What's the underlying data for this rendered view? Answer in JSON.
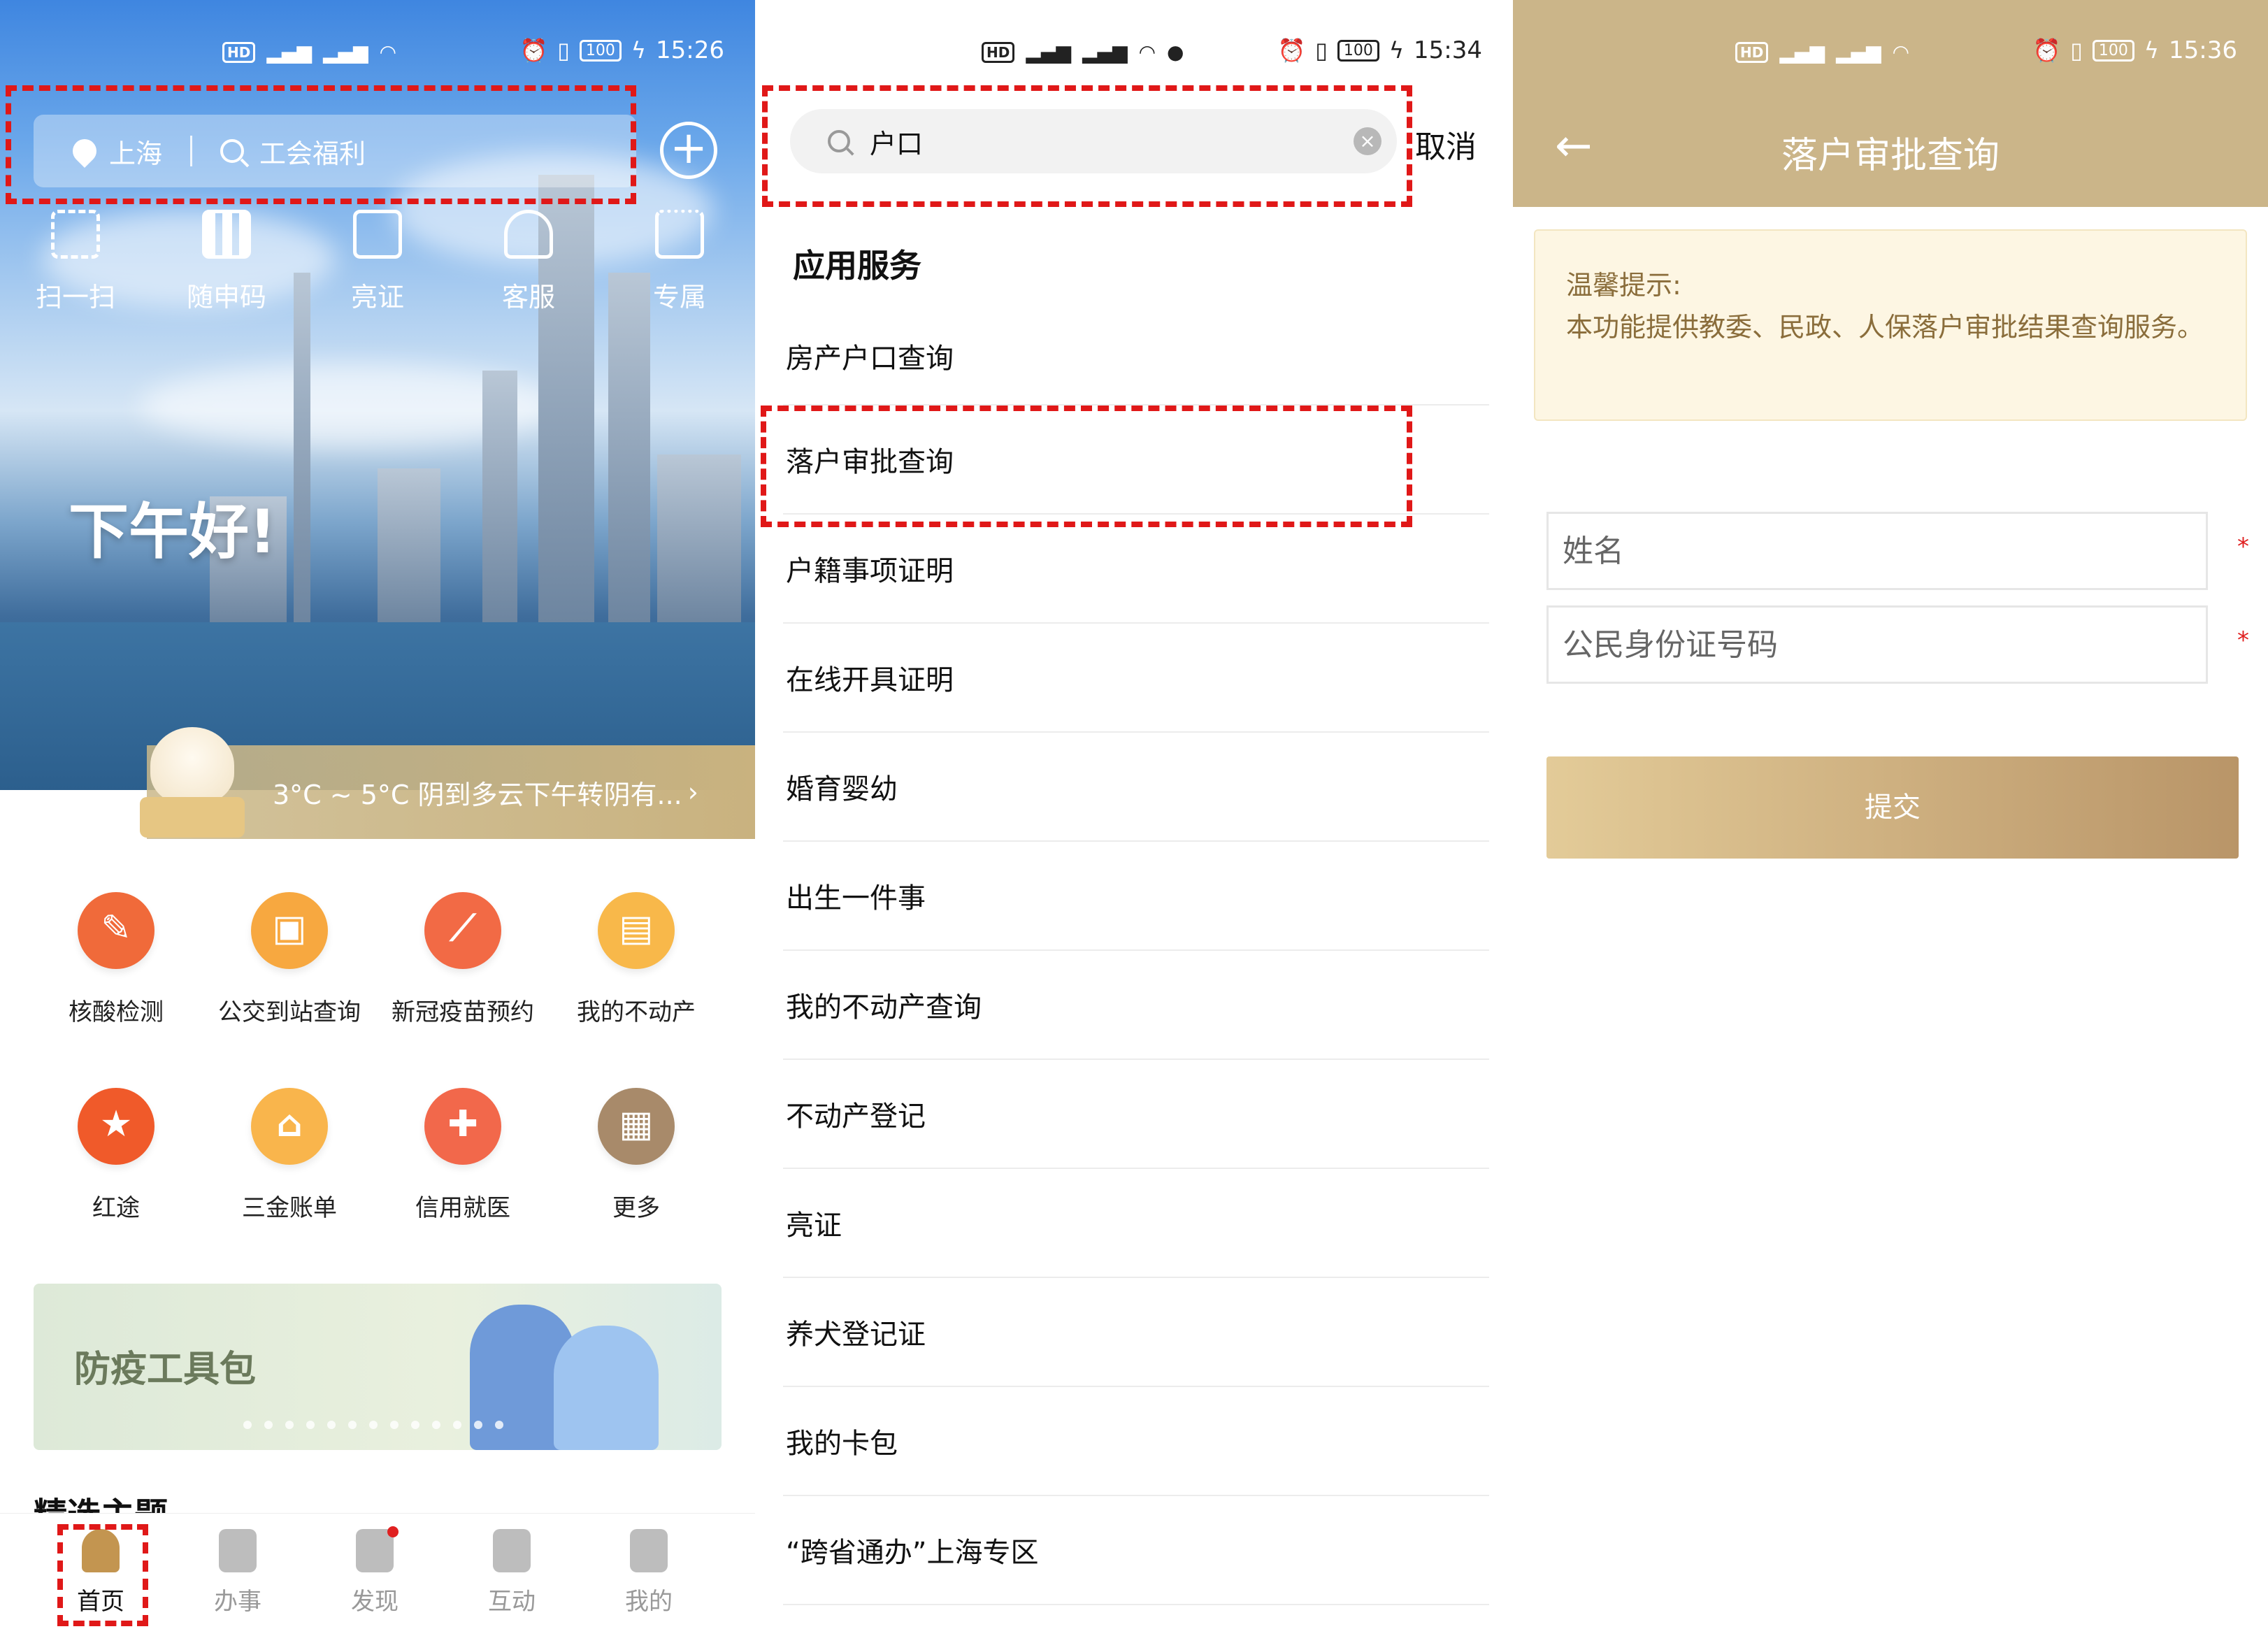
{
  "colors": {
    "accent_gold": "#c39550",
    "highlight_red": "#e01818",
    "header_gold": "#cbb589"
  },
  "panel1": {
    "status": {
      "time": "15:26",
      "battery": "100"
    },
    "city": "上海",
    "search_hint": "工会福利",
    "quick_actions": [
      {
        "label": "扫一扫",
        "icon": "scan-icon"
      },
      {
        "label": "随申码",
        "icon": "qr-code-icon"
      },
      {
        "label": "亮证",
        "icon": "id-card-icon"
      },
      {
        "label": "客服",
        "icon": "headset-icon"
      },
      {
        "label": "专属",
        "icon": "crown-icon"
      }
    ],
    "greeting": "下午好!",
    "weather": "3°C ~ 5°C  阴到多云下午转阴有...",
    "services": [
      {
        "label": "核酸检测",
        "icon": "swab-icon",
        "color": "#f06a3a"
      },
      {
        "label": "公交到站查询",
        "icon": "bus-icon",
        "color": "#f7a840"
      },
      {
        "label": "新冠疫苗预约",
        "icon": "syringe-icon",
        "color": "#f26a45"
      },
      {
        "label": "我的不动产",
        "icon": "document-icon",
        "color": "#f8b84a"
      },
      {
        "label": "红途",
        "icon": "star-flag-icon",
        "color": "#f05a2a"
      },
      {
        "label": "三金账单",
        "icon": "money-house-icon",
        "color": "#f9b54c"
      },
      {
        "label": "信用就医",
        "icon": "medical-card-icon",
        "color": "#f2684b"
      },
      {
        "label": "更多",
        "icon": "grid-more-icon",
        "color": "#a88a6a"
      }
    ],
    "banner_title": "防疫工具包",
    "section_heading": "精选主题",
    "tabs": [
      {
        "label": "首页",
        "icon": "home-icon"
      },
      {
        "label": "办事",
        "icon": "pen-icon"
      },
      {
        "label": "发现",
        "icon": "discover-icon"
      },
      {
        "label": "互动",
        "icon": "lotus-icon"
      },
      {
        "label": "我的",
        "icon": "profile-icon"
      }
    ]
  },
  "panel2": {
    "status": {
      "time": "15:34",
      "battery": "100"
    },
    "search_value": "户口",
    "cancel_label": "取消",
    "section_heading": "应用服务",
    "results": [
      "房产户口查询",
      "落户审批查询",
      "户籍事项证明",
      "在线开具证明",
      "婚育婴幼",
      "出生一件事",
      "我的不动产查询",
      "不动产登记",
      "亮证",
      "养犬登记证",
      "我的卡包",
      "“跨省通办”上海专区"
    ]
  },
  "panel3": {
    "status": {
      "time": "15:36",
      "battery": "100"
    },
    "title": "落户审批查询",
    "tip_title": "温馨提示:",
    "tip_body": "本功能提供教委、民政、人保落户审批结果查询服务。",
    "name_placeholder": "姓名",
    "id_placeholder": "公民身份证号码",
    "required_mark": "*",
    "submit_label": "提交"
  }
}
